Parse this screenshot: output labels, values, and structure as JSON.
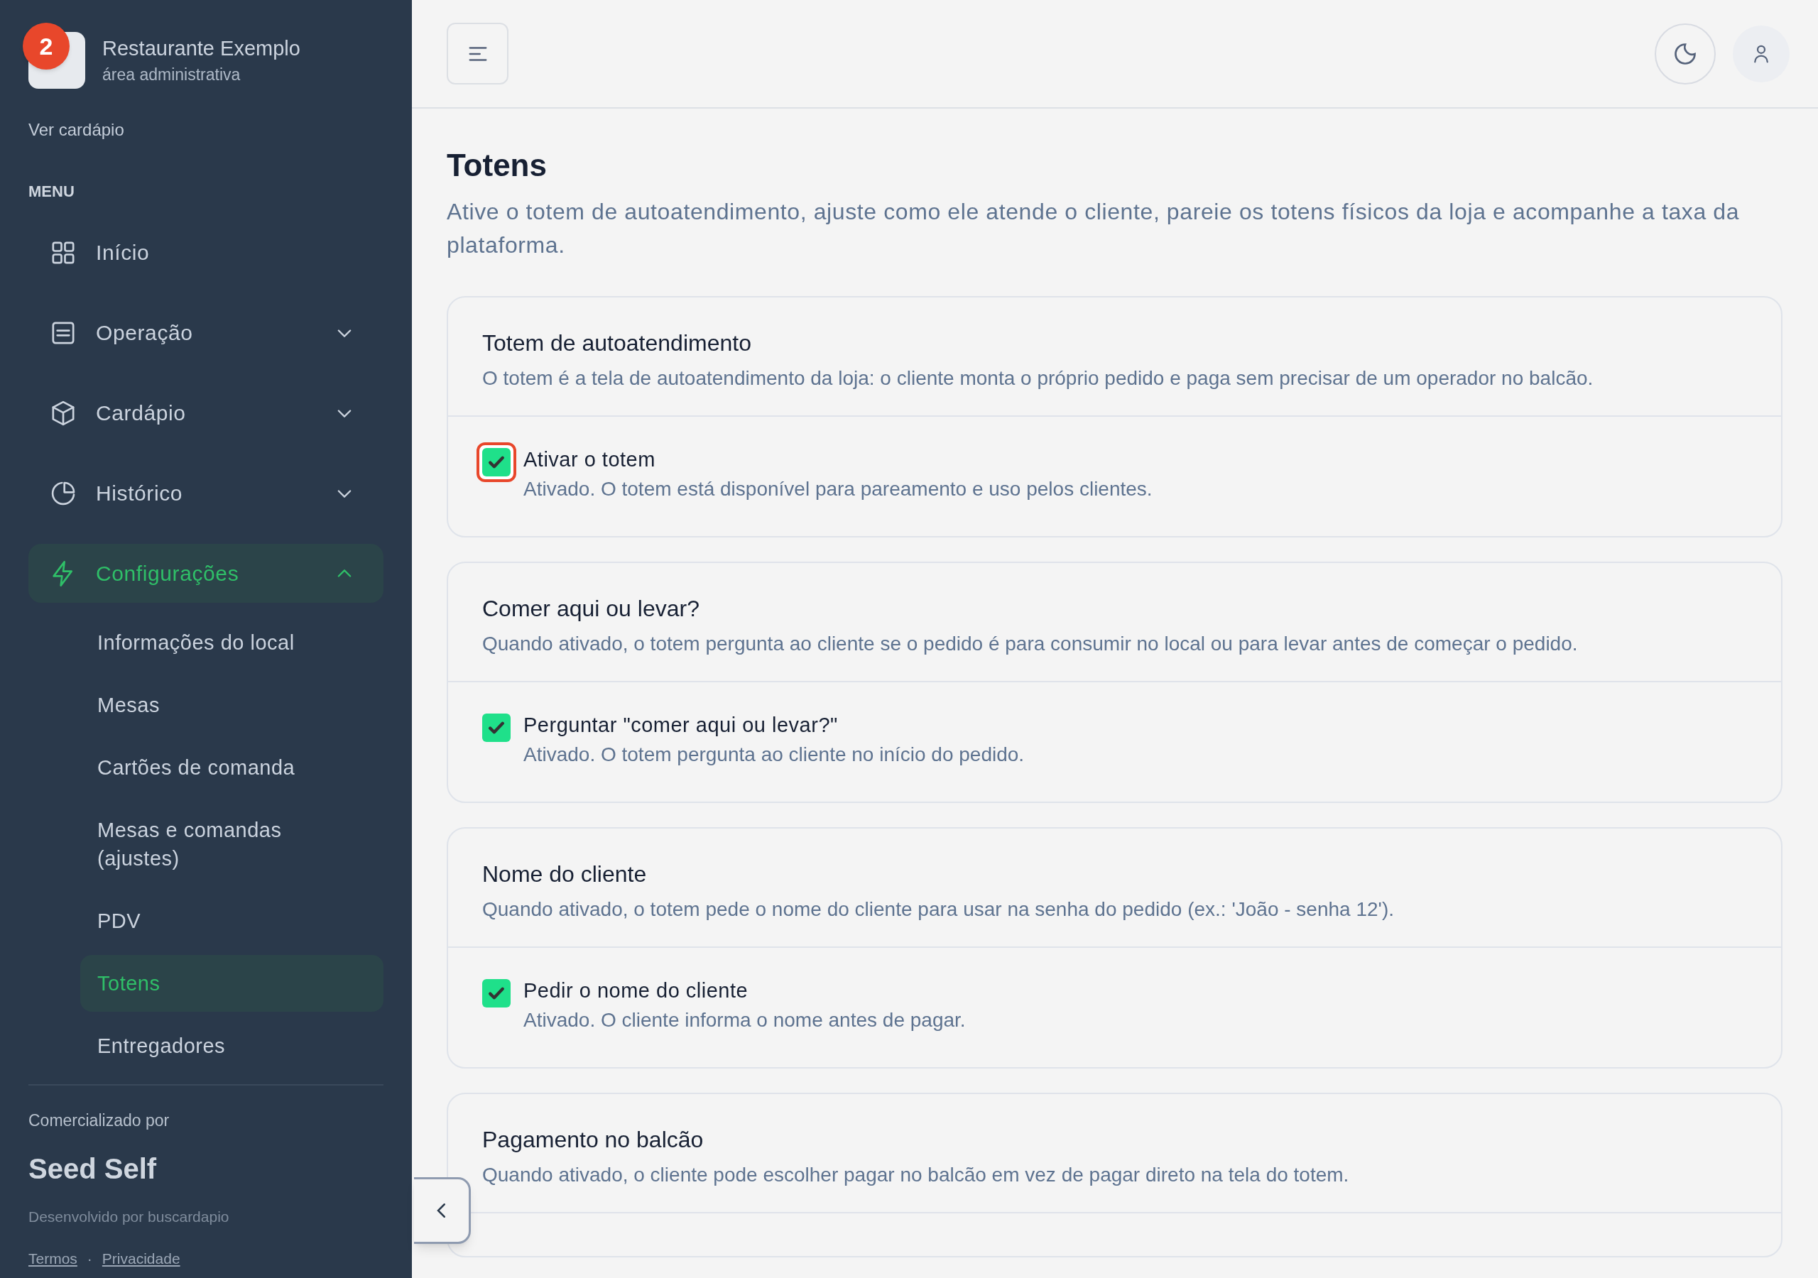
{
  "sidebar": {
    "logo_badge": "2",
    "restaurant": "Restaurante Exemplo",
    "subtitle": "área administrativa",
    "view_menu_link": "Ver cardápio",
    "menu_heading": "MENU",
    "items": [
      {
        "label": "Início",
        "selected": false
      },
      {
        "label": "Operação",
        "selected": false,
        "expanded": false
      },
      {
        "label": "Cardápio",
        "selected": false,
        "expanded": false
      },
      {
        "label": "Histórico",
        "selected": false,
        "expanded": false
      },
      {
        "label": "Configurações",
        "selected": true,
        "expanded": true,
        "children": [
          {
            "label": "Informações do local",
            "selected": false
          },
          {
            "label": "Mesas",
            "selected": false
          },
          {
            "label": "Cartões de comanda",
            "selected": false
          },
          {
            "label": "Mesas e comandas (ajustes)",
            "selected": false
          },
          {
            "label": "PDV",
            "selected": false
          },
          {
            "label": "Totens",
            "selected": true
          },
          {
            "label": "Entregadores",
            "selected": false
          }
        ]
      }
    ],
    "footer": {
      "sold_by": "Comercializado por",
      "brand": "Seed Self",
      "developer": "Desenvolvido por buscardapio",
      "links": [
        "Termos",
        "Privacidade"
      ],
      "separator": "·"
    }
  },
  "page": {
    "title": "Totens",
    "description": "Ative o totem de autoatendimento, ajuste como ele atende o cliente, pareie os totens físicos da loja e acompanhe a taxa da plataforma."
  },
  "cards": [
    {
      "title": "Totem de autoatendimento",
      "description": "O totem é a tela de autoatendimento da loja: o cliente monta o próprio pedido e paga sem precisar de um operador no balcão.",
      "toggle": {
        "label": "Ativar o totem",
        "description": "Ativado. O totem está disponível para pareamento e uso pelos clientes.",
        "checked": true,
        "focused": true
      }
    },
    {
      "title": "Comer aqui ou levar?",
      "description": "Quando ativado, o totem pergunta ao cliente se o pedido é para consumir no local ou para levar antes de começar o pedido.",
      "toggle": {
        "label": "Perguntar \"comer aqui ou levar?\"",
        "description": "Ativado. O totem pergunta ao cliente no início do pedido.",
        "checked": true,
        "focused": false
      }
    },
    {
      "title": "Nome do cliente",
      "description": "Quando ativado, o totem pede o nome do cliente para usar na senha do pedido (ex.: 'João - senha 12').",
      "toggle": {
        "label": "Pedir o nome do cliente",
        "description": "Ativado. O cliente informa o nome antes de pagar.",
        "checked": true,
        "focused": false
      }
    },
    {
      "title": "Pagamento no balcão",
      "description": "Quando ativado, o cliente pode escolher pagar no balcão em vez de pagar direto na tela do totem."
    }
  ]
}
